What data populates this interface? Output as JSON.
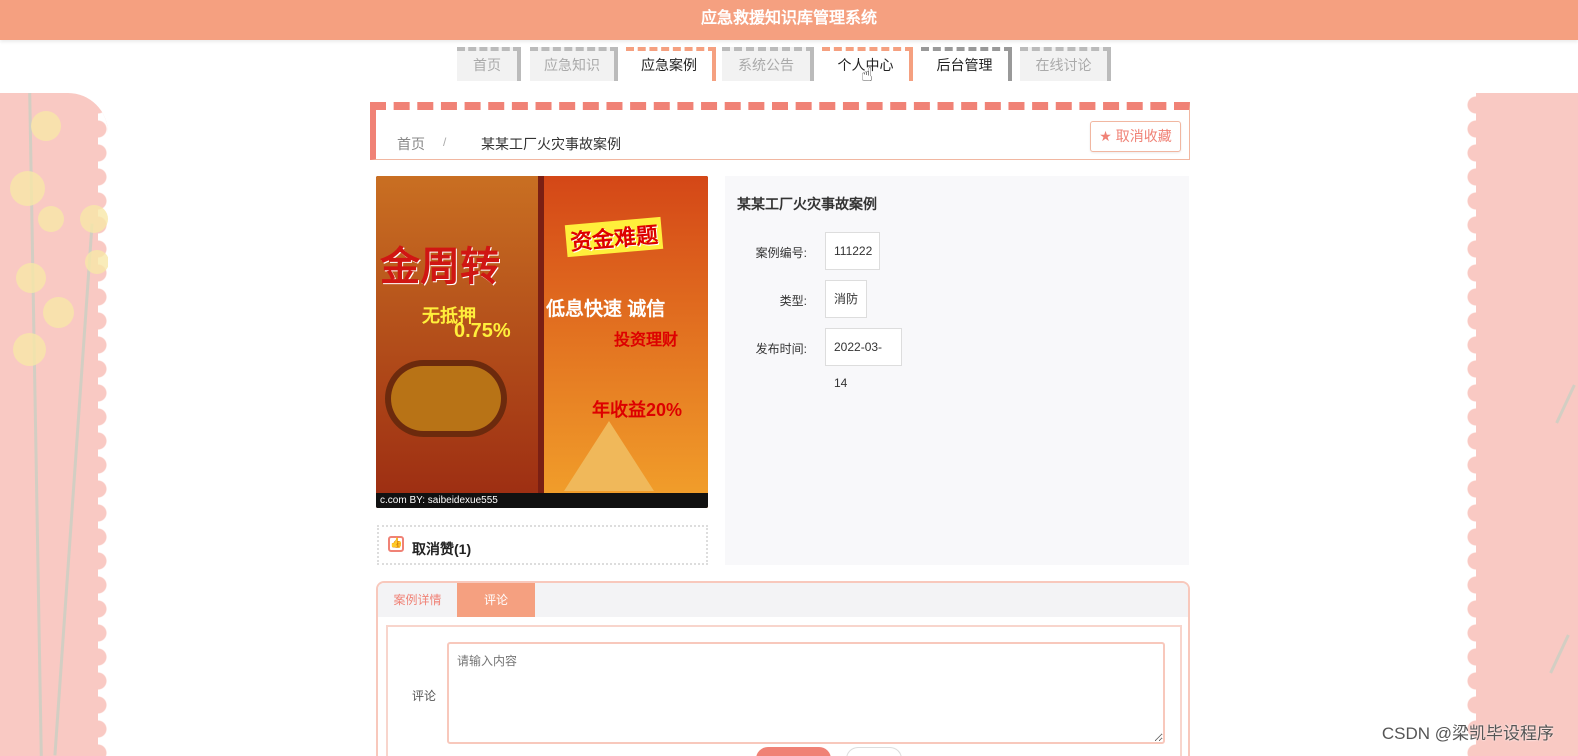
{
  "app": {
    "title": "应急救援知识库管理系统"
  },
  "nav": {
    "items": [
      {
        "label": "首页"
      },
      {
        "label": "应急知识"
      },
      {
        "label": "应急案例"
      },
      {
        "label": "系统公告"
      },
      {
        "label": "个人中心"
      },
      {
        "label": "后台管理"
      },
      {
        "label": "在线讨论"
      }
    ]
  },
  "breadcrumb": {
    "home": "首页",
    "separator": "/",
    "current": "某某工厂火灾事故案例"
  },
  "actions": {
    "favorite": "取消收藏",
    "like": "取消赞(1)"
  },
  "poster": {
    "left_title": "金周转",
    "left_small_1": "无抵押",
    "left_small_2": "0.75%",
    "right_title": "资金难题",
    "right_line_1": "低息快速 诚信",
    "right_line_2": "投资理财",
    "right_line_3": "年收益20%",
    "footer": "c.com  BY: saibeidexue555"
  },
  "details": {
    "title": "某某工厂火灾事故案例",
    "fields": [
      {
        "label": "案例编号:",
        "value": "111222"
      },
      {
        "label": "类型:",
        "value": "消防"
      },
      {
        "label": "发布时间:",
        "value": "2022-03-14"
      }
    ]
  },
  "tabs": {
    "detail": "案例详情",
    "comment": "评论"
  },
  "comment": {
    "label": "评论",
    "placeholder": "请输入内容"
  },
  "watermark": "CSDN @梁凯毕设程序",
  "colors": {
    "accent": "#f5a080",
    "secondary": "#f08276",
    "soft": "#f9c9c3"
  },
  "icons": {
    "favorite": "star-icon",
    "like": "thumb-up-icon",
    "cursor": "hand-pointer-icon"
  }
}
